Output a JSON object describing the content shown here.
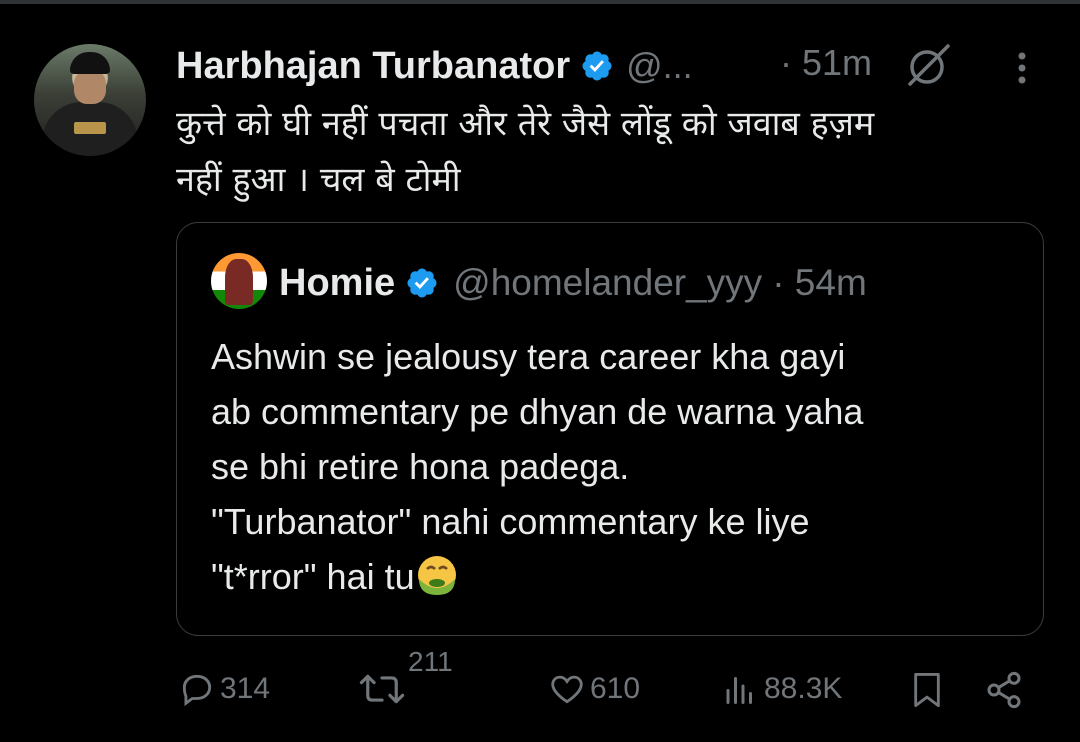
{
  "tweet": {
    "author_name": "Harbhajan Turbanator",
    "author_handle": "@...",
    "time": "· 51m",
    "text_line1": "कुत्ते को घी नहीं पचता और तेरे जैसे लोंडू को जवाब हज़म",
    "text_line2": "नहीं हुआ । चल बे टोमी"
  },
  "quote": {
    "author_name": "Homie",
    "author_handle": "@homelander_yyy",
    "time": "· 54m",
    "text": "Ashwin se jealousy tera career kha gayi\nab commentary pe dhyan de warna yaha\nse bhi retire hona padega.\n\"Turbanator\" nahi commentary ke liye\n\"t*rror\" hai tu"
  },
  "actions": {
    "replies": "314",
    "reposts": "211",
    "likes": "610",
    "views": "88.3K"
  },
  "icons": {
    "verified": "verified-badge-icon",
    "grok": "grok-icon",
    "more": "more-icon",
    "reply": "reply-icon",
    "repost": "repost-icon",
    "like": "like-icon",
    "views": "views-icon",
    "bookmark": "bookmark-icon",
    "share": "share-icon",
    "emoji": "nauseated-face-emoji"
  },
  "colors": {
    "background": "#000000",
    "text": "#e7e9ea",
    "secondary": "#71767b",
    "verified": "#1d9bf0"
  }
}
